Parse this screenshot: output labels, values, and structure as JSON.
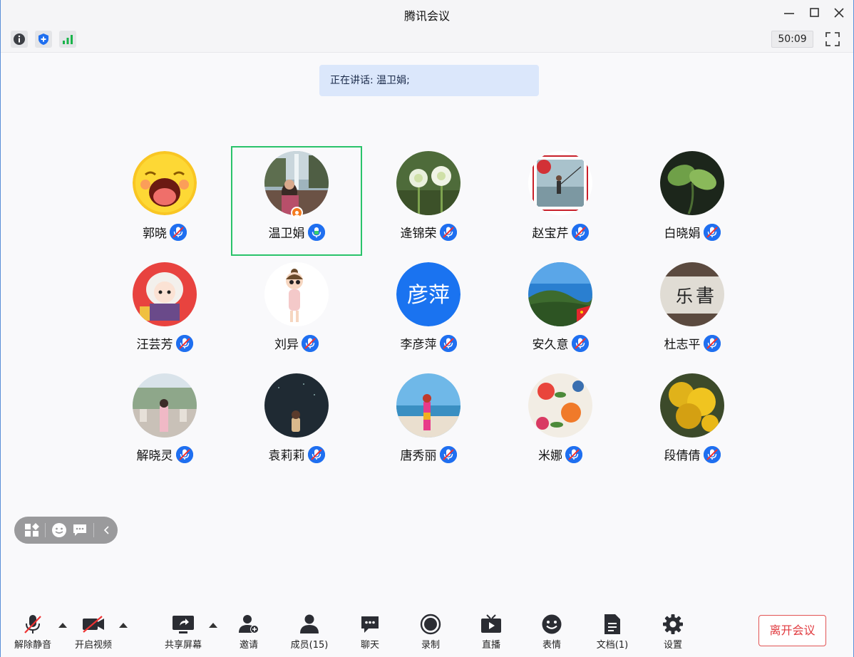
{
  "window": {
    "title": "腾讯会议"
  },
  "status": {
    "timer": "50:09",
    "icons": [
      "info-icon",
      "shield-icon",
      "signal-icon",
      "fullscreen-icon"
    ]
  },
  "speaking": {
    "text": "正在讲话: 温卫娟;"
  },
  "participants": [
    {
      "name": "郭晓",
      "avatar": "laughing-emoji",
      "mic": "muted"
    },
    {
      "name": "温卫娟",
      "avatar": "photo-fountain",
      "mic": "active",
      "speaking": true,
      "host": true
    },
    {
      "name": "逄锦荣",
      "avatar": "photo-flowers",
      "mic": "muted"
    },
    {
      "name": "赵宝芹",
      "avatar": "photo-fishing",
      "mic": "muted"
    },
    {
      "name": "白晓娟",
      "avatar": "photo-leaves",
      "mic": "muted"
    },
    {
      "name": "汪芸芳",
      "avatar": "cartoon-girl",
      "mic": "muted"
    },
    {
      "name": "刘异",
      "avatar": "cartoon-doll",
      "mic": "muted"
    },
    {
      "name": "李彦萍",
      "avatar": "initials",
      "initials": "彦萍",
      "avatar_color": "#1a73f0",
      "mic": "muted"
    },
    {
      "name": "安久意",
      "avatar": "photo-landscape",
      "mic": "muted"
    },
    {
      "name": "杜志平",
      "avatar": "calligraphy",
      "mic": "muted"
    },
    {
      "name": "解晓灵",
      "avatar": "photo-park",
      "mic": "muted"
    },
    {
      "name": "袁莉莉",
      "avatar": "night-girl",
      "mic": "muted"
    },
    {
      "name": "唐秀丽",
      "avatar": "photo-beach",
      "mic": "muted"
    },
    {
      "name": "米娜",
      "avatar": "floral-pattern",
      "mic": "muted"
    },
    {
      "name": "段倩倩",
      "avatar": "photo-yellow-tree",
      "mic": "muted"
    }
  ],
  "toolbar": {
    "unmute": "解除静音",
    "video": "开启视频",
    "share": "共享屏幕",
    "invite": "邀请",
    "members": "成员(15)",
    "chat": "聊天",
    "record": "录制",
    "live": "直播",
    "emoji": "表情",
    "docs": "文档(1)",
    "settings": "设置",
    "leave": "离开会议"
  }
}
